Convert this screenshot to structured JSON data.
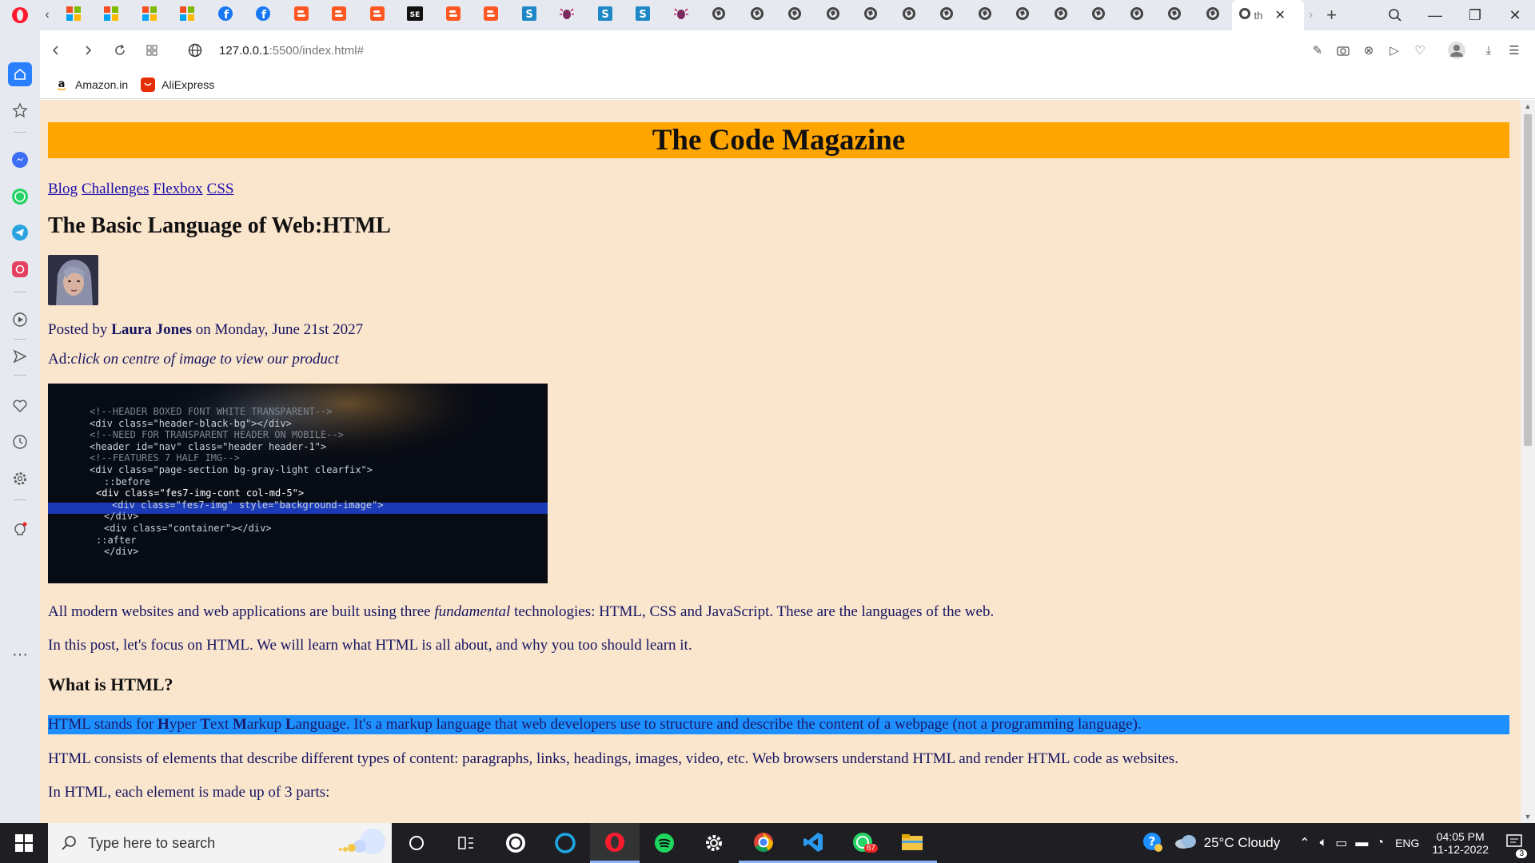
{
  "browser": {
    "active_tab_title": "th",
    "url_host": "127.0.0.1",
    "url_path": ":5500/index.html#",
    "bookmarks": [
      {
        "label": "Amazon.in",
        "icon": "amazon-icon"
      },
      {
        "label": "AliExpress",
        "icon": "aliexpress-icon"
      }
    ],
    "tabs": [
      {
        "icon": "microsoft-icon"
      },
      {
        "icon": "microsoft-icon"
      },
      {
        "icon": "microsoft-icon"
      },
      {
        "icon": "microsoft-icon"
      },
      {
        "icon": "facebook-icon"
      },
      {
        "icon": "facebook-icon"
      },
      {
        "icon": "blogger-icon"
      },
      {
        "icon": "blogger-icon"
      },
      {
        "icon": "blogger-icon"
      },
      {
        "icon": "se-icon",
        "text": "SE"
      },
      {
        "icon": "blogger-icon"
      },
      {
        "icon": "blogger-icon"
      },
      {
        "icon": "s-icon",
        "text": "S"
      },
      {
        "icon": "bug-icon"
      },
      {
        "icon": "s-icon",
        "text": "S"
      },
      {
        "icon": "s-icon",
        "text": "S"
      },
      {
        "icon": "bug-icon"
      },
      {
        "icon": "globe-icon"
      },
      {
        "icon": "globe-icon"
      },
      {
        "icon": "globe-icon"
      },
      {
        "icon": "globe-icon"
      },
      {
        "icon": "globe-icon"
      },
      {
        "icon": "globe-icon"
      },
      {
        "icon": "globe-icon"
      },
      {
        "icon": "globe-icon"
      },
      {
        "icon": "globe-icon"
      },
      {
        "icon": "globe-icon"
      },
      {
        "icon": "globe-icon"
      },
      {
        "icon": "globe-icon"
      },
      {
        "icon": "globe-icon"
      },
      {
        "icon": "globe-icon"
      }
    ]
  },
  "page": {
    "masthead": "The Code Magazine",
    "nav": [
      "Blog",
      "Challenges",
      "Flexbox",
      "CSS"
    ],
    "title": "The Basic Language of Web:HTML",
    "posted_prefix": "Posted by ",
    "author": "Laura Jones",
    "posted_suffix": " on Monday, June 21st 2027",
    "ad_prefix": "Ad:",
    "ad_text": "click on centre of image to view our product",
    "p1_before": "All modern websites and web applications are built using three ",
    "p1_em": "fundamental",
    "p1_after": " technologies: HTML, CSS and JavaScript. These are the languages of the web.",
    "p2": "In this post, let's focus on HTML. We will learn what HTML is all about, and why you too should learn it.",
    "h3": "What is HTML?",
    "p3_a": "HTML stands for ",
    "p3_H": "H",
    "p3_b": "yper ",
    "p3_T": "T",
    "p3_c": "ext ",
    "p3_M": "M",
    "p3_d": "arkup ",
    "p3_L": "L",
    "p3_e": "anguage. It's a markup language that web developers use to structure and describe the content of a webpage (not a programming language).",
    "p4": "HTML consists of elements that describe different types of content: paragraphs, links, headings, images, video, etc. Web browsers understand HTML and render HTML code as websites.",
    "p5": "In HTML, each element is made up of 3 parts:",
    "code_lines": [
      "<!--HEADER BOXED FONT WHITE TRANSPARENT-->",
      "<div class=\"header-black-bg\"></div>",
      "<!--NEED FOR TRANSPARENT HEADER ON MOBILE-->",
      "<header id=\"nav\" class=\"header header-1\">",
      "<!--FEATURES 7 HALF IMG-->",
      "<div class=\"page-section bg-gray-light clearfix\">",
      "::before",
      "<div class=\"fes7-img-cont col-md-5\">",
      "<div class=\"fes7-img\" style=\"background-image\">",
      "</div>",
      "<div class=\"container\"></div>",
      "::after",
      "</div>"
    ]
  },
  "taskbar": {
    "search_placeholder": "Type here to search",
    "weather": "25°C  Cloudy",
    "lang": "ENG",
    "time": "04:05 PM",
    "date": "11-12-2022",
    "whatsapp_badge": "67",
    "notif_count": "3"
  },
  "colors": {
    "page_bg": "#fae5cd",
    "masthead": "#ffa500",
    "highlight": "#1e90ff",
    "text": "#151562"
  }
}
